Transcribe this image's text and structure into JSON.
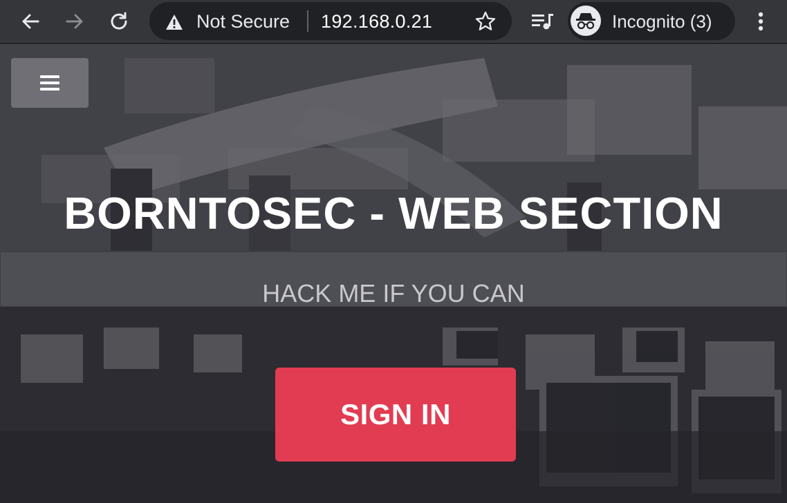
{
  "browser": {
    "security_label": "Not Secure",
    "url": "192.168.0.21",
    "profile_label": "Incognito (3)",
    "icons": {
      "back": "arrow-left-icon",
      "forward": "arrow-right-icon",
      "reload": "reload-icon",
      "security": "warning-triangle-icon",
      "bookmark": "star-icon",
      "media": "playlist-icon",
      "profile": "incognito-icon",
      "menu": "kebab-menu-icon"
    }
  },
  "page": {
    "title": "BORNTOSEC - WEB SECTION",
    "subtitle": "HACK ME IF YOU CAN",
    "signin_label": "SIGN IN",
    "accent_color": "#e23c52"
  }
}
